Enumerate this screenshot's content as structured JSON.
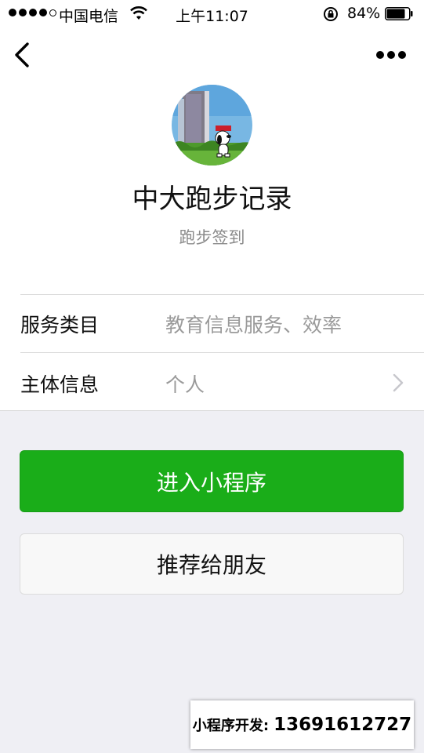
{
  "status_bar": {
    "carrier": "中国电信",
    "time": "上午11:07",
    "battery_percent": "84%",
    "signal_icon": "signal-dots-icon",
    "wifi_icon": "wifi-icon",
    "alarm_icon": "rotation-lock-icon",
    "battery_icon": "battery-icon",
    "battery_level": 0.84
  },
  "nav": {
    "back_icon": "chevron-left-icon",
    "more_icon": "more-dots-icon"
  },
  "profile": {
    "name": "中大跑步记录",
    "description": "跑步签到"
  },
  "info": {
    "rows": [
      {
        "label": "服务类目",
        "value": "教育信息服务、效率"
      },
      {
        "label": "主体信息",
        "value": "个人"
      }
    ]
  },
  "actions": {
    "enter_label": "进入小程序",
    "share_label": "推荐给朋友"
  },
  "watermark": {
    "label": "小程序开发:",
    "phone": "13691612727"
  },
  "colors": {
    "primary_green": "#1aad19",
    "background": "#efeff4"
  }
}
